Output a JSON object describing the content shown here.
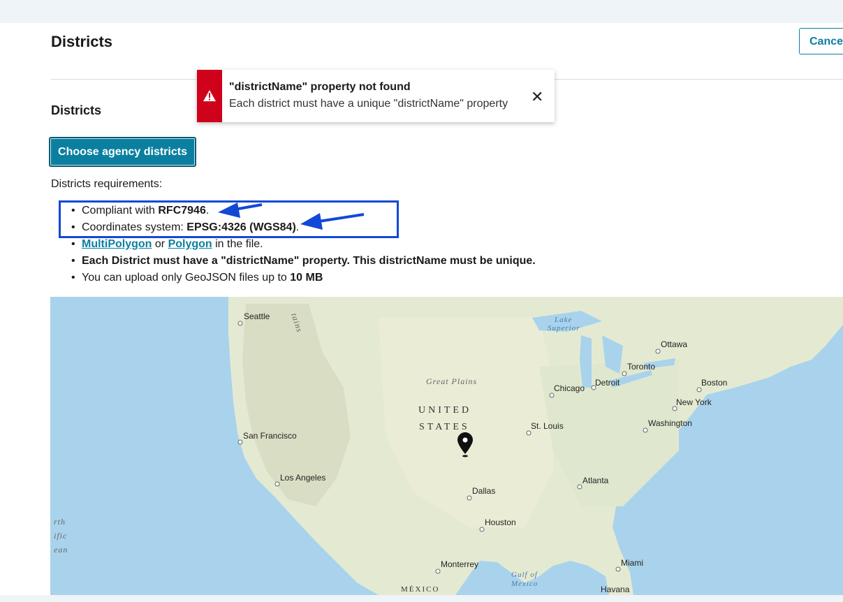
{
  "header": {
    "title": "Districts",
    "cancel_label": "Cancel"
  },
  "section": {
    "title": "Districts",
    "choose_button": "Choose agency districts"
  },
  "requirements": {
    "label": "Districts requirements:",
    "item1_prefix": "Compliant with ",
    "item1_bold": "RFC7946",
    "item1_suffix": ".",
    "item2_prefix": "Coordinates system: ",
    "item2_bold": "EPSG:4326 (WGS84)",
    "item2_suffix": ".",
    "item3_link1": "MultiPolygon",
    "item3_mid": " or ",
    "item3_link2": "Polygon",
    "item3_suffix": " in the file.",
    "item4_bold": "Each District must have a \"districtName\" property. This districtName must be unique.",
    "item5_prefix": "You can upload only GeoJSON files up to ",
    "item5_bold": "10 MB"
  },
  "toast": {
    "title": "\"districtName\" property not found",
    "message": "Each district must have a unique \"districtName\" property",
    "icon": "warning-triangle-icon",
    "close_icon": "close-icon",
    "accent": "#d0021b"
  },
  "map": {
    "country_line1": "UNITED",
    "country_line2": "STATES",
    "region_great_plains": "Great Plains",
    "mountains_fragment": "tains",
    "lake_superior_1": "Lake",
    "lake_superior_2": "Superior",
    "gulf_1": "Gulf of",
    "gulf_2": "Mexico",
    "mexico": "MÉXICO",
    "pacific_1": "rth",
    "pacific_2": "ific",
    "pacific_3": "ean",
    "cities": {
      "seattle": "Seattle",
      "san_francisco": "San Francisco",
      "los_angeles": "Los Angeles",
      "dallas": "Dallas",
      "houston": "Houston",
      "monterrey": "Monterrey",
      "chicago": "Chicago",
      "detroit": "Detroit",
      "st_louis": "St. Louis",
      "atlanta": "Atlanta",
      "miami": "Miami",
      "havana": "Havana",
      "washington": "Washington",
      "new_york": "New York",
      "boston": "Boston",
      "toronto": "Toronto",
      "ottawa": "Ottawa"
    },
    "marker_icon": "map-pin-icon"
  },
  "annotation": {
    "highlight_color": "#1348d6"
  },
  "colors": {
    "primary": "#0b7fa0",
    "error": "#d0021b",
    "annotation": "#1348d6"
  }
}
